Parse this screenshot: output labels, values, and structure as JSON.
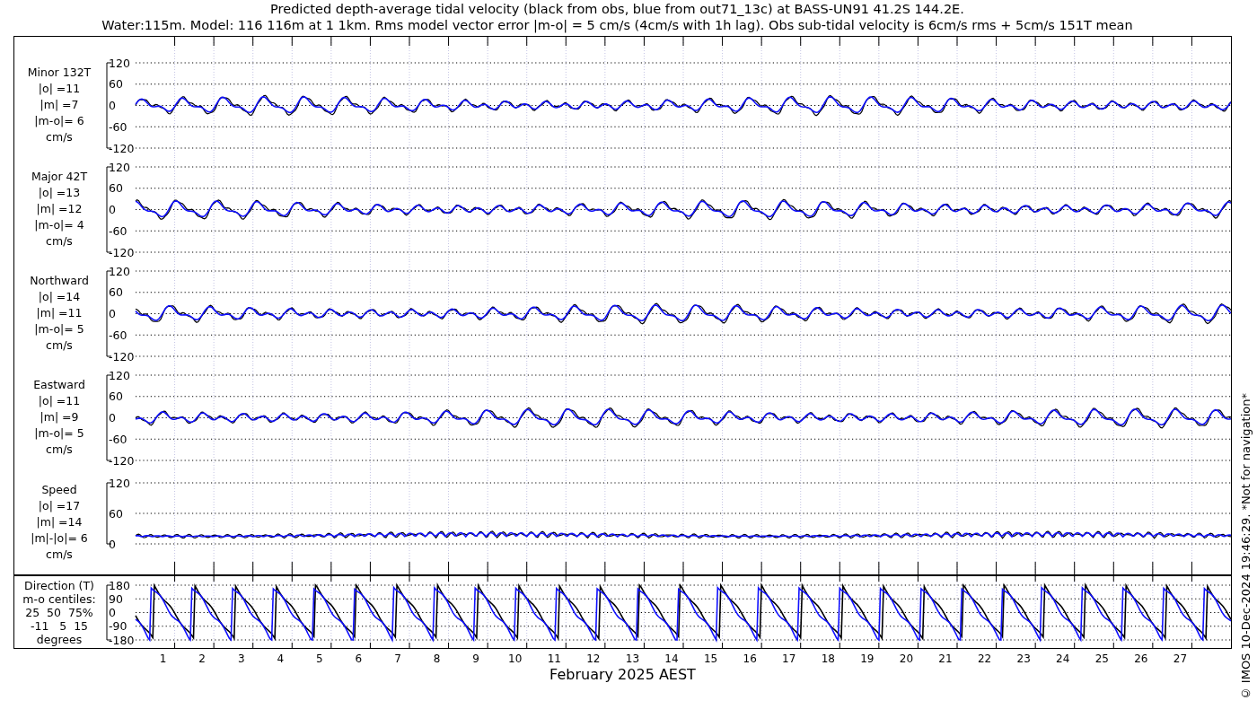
{
  "title": [
    "Predicted depth-average tidal velocity (black from obs, blue from out71_13c) at BASS-UN91 41.2S 144.2E.",
    "Water:115m. Model: 116 116m at 1 1km. Rms model vector error |m-o| = 5 cm/s (4cm/s with 1h lag). Obs sub-tidal velocity is 6cm/s rms + 5cm/s 151T mean"
  ],
  "panels": [
    {
      "kind": "velocity",
      "label_lines": [
        "Minor 132T",
        "|o| =11",
        "|m| =7",
        "|m-o|= 6",
        "cm/s"
      ],
      "yticks": [
        "120",
        "60",
        "0",
        "-60",
        "-120"
      ]
    },
    {
      "kind": "velocity",
      "label_lines": [
        "Major 42T",
        "|o| =13",
        "|m| =12",
        "|m-o|= 4",
        "cm/s"
      ],
      "yticks": [
        "120",
        "60",
        "0",
        "-60",
        "-120"
      ]
    },
    {
      "kind": "velocity",
      "label_lines": [
        "Northward",
        "|o| =14",
        "|m| =11",
        "|m-o|= 5",
        "cm/s"
      ],
      "yticks": [
        "120",
        "60",
        "0",
        "-60",
        "-120"
      ]
    },
    {
      "kind": "velocity",
      "label_lines": [
        "Eastward",
        "|o| =11",
        "|m| =9",
        "|m-o|= 5",
        "cm/s"
      ],
      "yticks": [
        "120",
        "60",
        "0",
        "-60",
        "-120"
      ]
    },
    {
      "kind": "speed",
      "label_lines": [
        "Speed",
        "|o| =17",
        "|m| =14",
        "|m|-|o|= 6",
        "cm/s"
      ],
      "yticks": [
        "120",
        "60",
        "0"
      ]
    },
    {
      "kind": "direction",
      "label_lines": [
        "Direction (T)",
        "m-o centiles:",
        "25  50  75%",
        "-11   5  15",
        "degrees"
      ],
      "yticks": [
        "180",
        "90",
        "0",
        "-90",
        "-180"
      ]
    }
  ],
  "xticks": [
    "1",
    "2",
    "3",
    "4",
    "5",
    "6",
    "7",
    "8",
    "9",
    "10",
    "11",
    "12",
    "13",
    "14",
    "15",
    "16",
    "17",
    "18",
    "19",
    "20",
    "21",
    "22",
    "23",
    "24",
    "25",
    "26",
    "27"
  ],
  "xlabel": "February 2025 AEST",
  "credit": "© IMOS 10-Dec-2024 19:46:29. *Not for navigation*"
}
